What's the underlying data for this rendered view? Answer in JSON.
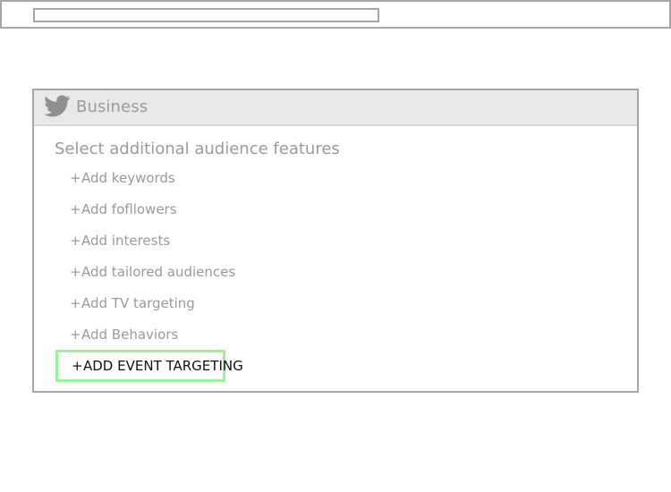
{
  "app": {
    "top_bar": {
      "input_value": ""
    }
  },
  "panel": {
    "header": {
      "icon": "twitter-bird-icon",
      "title": "Business"
    },
    "section_title": "Select additional audience features",
    "features": [
      {
        "label": "Add keywords"
      },
      {
        "label": "Add fofllowers"
      },
      {
        "label": "Add interests"
      },
      {
        "label": "Add tailored audiences"
      },
      {
        "label": "Add TV targeting"
      },
      {
        "label": "Add Behaviors"
      }
    ],
    "highlighted_action": {
      "label": "ADD EVENT TARGETING"
    }
  },
  "colors": {
    "highlight_border": "#98f39a",
    "muted_text": "#9a9a9a",
    "header_bg": "#e8e8e8"
  }
}
